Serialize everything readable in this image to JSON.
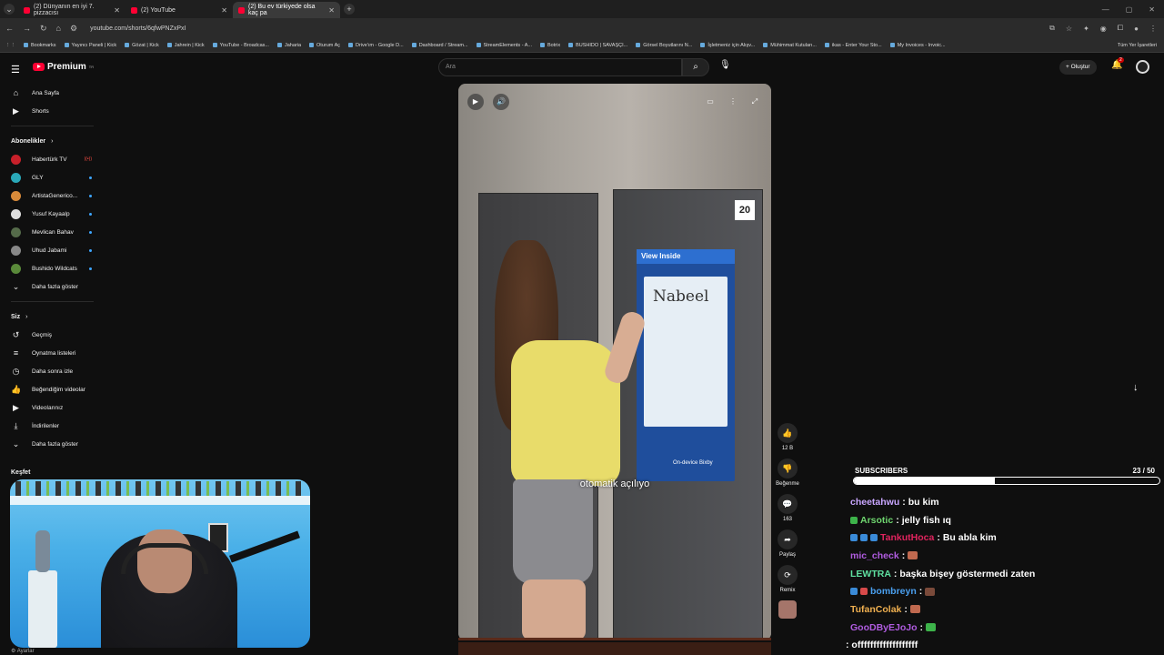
{
  "browser": {
    "tabs": [
      {
        "title": "(2) Dünyanın en iyi 7. pizzacısı",
        "active": false
      },
      {
        "title": "(2) YouTube",
        "active": false
      },
      {
        "title": "(2) Bu ev türkiyede olsa kaç pa",
        "active": true
      }
    ],
    "url": "youtube.com/shorts/6qfwPNZxPxI",
    "bookmarks": [
      "Bookmarks",
      "Yayıncı Paneli | Kick",
      "Gözat | Kick",
      "Jahrein | Kick",
      "YouTube - Broadcas...",
      "Jaharia",
      "Oturum Aç",
      "Drive'ım - Google D...",
      "Dashboard / Stream...",
      "StreamElements - A...",
      "Botrix",
      "BUSHIDO | SAVAŞÇI...",
      "Görsel Boyutlarını N...",
      "İşletmeniz için Alışv...",
      "Mühimmat Kutuları...",
      "ikas - Enter Your Sto...",
      "My Invoices - Invoic..."
    ],
    "all_bookmarks": "Tüm Yer İşaretleri"
  },
  "header": {
    "logo_text": "Premium",
    "logo_sup": "TR",
    "search_placeholder": "Ara",
    "create_label": "Oluştur",
    "notif_count": "2"
  },
  "sidebar": {
    "main": [
      {
        "label": "Ana Sayfa",
        "icon": "home-icon"
      },
      {
        "label": "Shorts",
        "icon": "shorts-icon"
      }
    ],
    "subs_header": "Abonelikler",
    "subscriptions": [
      {
        "label": "Habertürk TV",
        "color": "#c8202a",
        "live": "((•))"
      },
      {
        "label": "GLY",
        "color": "#2aa8b8"
      },
      {
        "label": "ArtistaGenerico...",
        "color": "#d88a3a"
      },
      {
        "label": "Yusuf Kayaalp",
        "color": "#dddddd"
      },
      {
        "label": "Mevlican Bahav",
        "color": "#556b4a"
      },
      {
        "label": "Uhud Jabami",
        "color": "#888888"
      },
      {
        "label": "Bushido Wildcats",
        "color": "#5a8a3a"
      }
    ],
    "subs_more": "Daha fazla göster",
    "you_header": "Siz",
    "you_items": [
      {
        "label": "Geçmiş",
        "icon": "history-icon"
      },
      {
        "label": "Oynatma listeleri",
        "icon": "playlist-icon"
      },
      {
        "label": "Daha sonra izle",
        "icon": "watch-later-icon"
      },
      {
        "label": "Beğendiğim videolar",
        "icon": "like-icon"
      },
      {
        "label": "Videolarınız",
        "icon": "video-icon"
      },
      {
        "label": "İndirilenler",
        "icon": "download-icon"
      },
      {
        "label": "Daha fazla göster",
        "icon": "chevron-down-icon"
      }
    ],
    "explore": "Keşfet",
    "settings": "Ayarlar"
  },
  "video": {
    "caption": "otomatik açılıyo",
    "screen_title": "View Inside",
    "screen_text": "Nabeel",
    "bixby": "On-device Bixby",
    "badge": "20"
  },
  "actions": {
    "likes": "12 B",
    "dislike": "Beğenme",
    "comments": "163",
    "share": "Paylaş",
    "remix": "Remix"
  },
  "overlay": {
    "subs_label": "SUBSCRIBERS",
    "subs_count": "23 / 50",
    "subs_progress": 0.46,
    "chat": [
      {
        "user": "cheetahwu",
        "color": "#c9a6ff",
        "msg": "bu kim",
        "badges": []
      },
      {
        "user": "Arsotic",
        "color": "#6fd66f",
        "msg": "jelly fish ıq",
        "badges": [
          "#3db34a"
        ]
      },
      {
        "user": "TankutHoca",
        "color": "#e0245e",
        "msg": "Bu abla kim",
        "badges": [
          "#3a8bd8",
          "#3a8bd8",
          "#3a8bd8"
        ]
      },
      {
        "user": "mic_check",
        "color": "#b05ce0",
        "msg": "",
        "emote": "#c0694f",
        "badges": []
      },
      {
        "user": "LEWTRA",
        "color": "#5fe0a0",
        "msg": "başka bişey göstermedi zaten",
        "badges": []
      },
      {
        "user": "bombreyn",
        "color": "#4aa0f0",
        "msg": "",
        "emote": "#7a4a3a",
        "badges": [
          "#3a8bd8",
          "#d84a4a"
        ]
      },
      {
        "user": "TufanColak",
        "color": "#f0b050",
        "msg": "",
        "emote": "#c0694f",
        "badges": []
      },
      {
        "user": "GooDByEJoJo",
        "color": "#b05ce0",
        "msg": "",
        "emote": "#3db34a",
        "badges": []
      },
      {
        "user": "",
        "color": "#ffffff",
        "msg": ": offfffffffffffffffff",
        "badges": []
      }
    ]
  }
}
